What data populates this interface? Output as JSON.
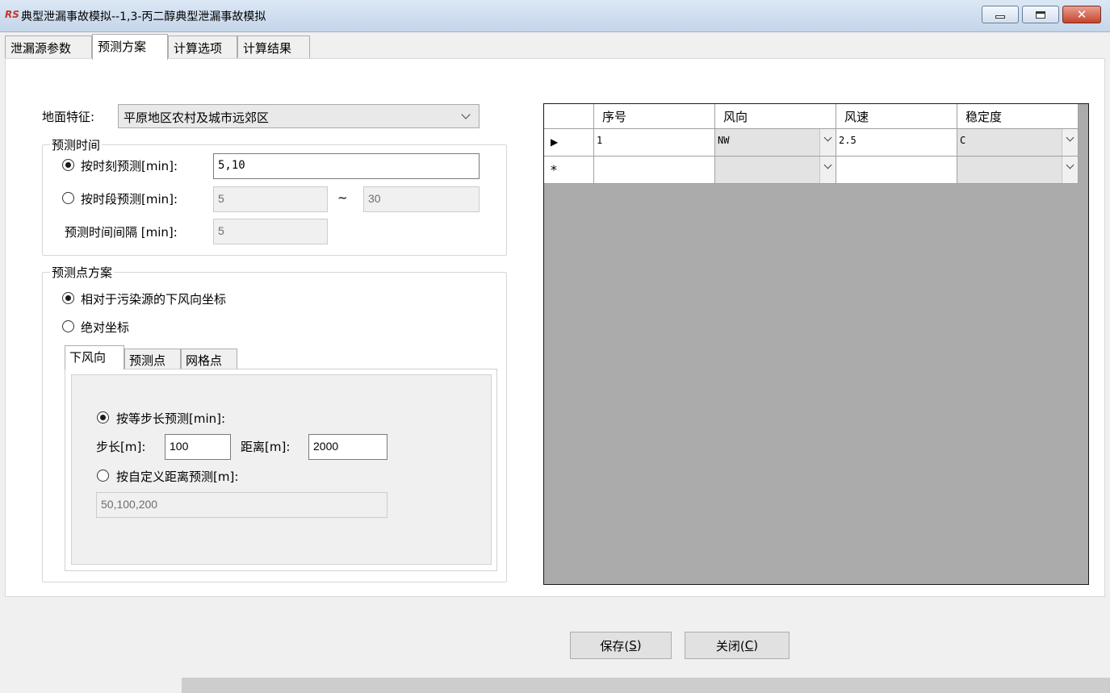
{
  "window": {
    "logo_text": "RS",
    "title": "典型泄漏事故模拟--1,3-丙二醇典型泄漏事故模拟"
  },
  "tabs": [
    "泄漏源参数",
    "预测方案",
    "计算选项",
    "计算结果"
  ],
  "active_tab": "预测方案",
  "ground": {
    "label": "地面特征:",
    "value": "平原地区农村及城市远郊区"
  },
  "time": {
    "title": "预测时间",
    "moment_label": "按时刻预测[min]:",
    "moment_value": "5,10",
    "moment_selected": true,
    "range_label": "按时段预测[min]:",
    "range_from": "5",
    "range_sep": "~",
    "range_to": "30",
    "interval_label": "预测时间间隔 [min]:",
    "interval_value": "5"
  },
  "points": {
    "title": "预测点方案",
    "relative_label": "相对于污染源的下风向坐标",
    "relative_selected": true,
    "absolute_label": "绝对坐标",
    "tabs": [
      "下风向",
      "预测点",
      "网格点"
    ],
    "active_tab": "下风向",
    "step_mode_label": "按等步长预测[min]:",
    "step_label": "步长[m]:",
    "step_value": "100",
    "distance_label": "距离[m]:",
    "distance_value": "2000",
    "custom_label": "按自定义距离预测[m]:",
    "custom_value": "50,100,200"
  },
  "grid": {
    "columns": [
      "序号",
      "风向",
      "风速",
      "稳定度"
    ],
    "rows": [
      {
        "marker": "▶",
        "index": "1",
        "direction": "NW",
        "speed": "2.5",
        "stability": "C"
      },
      {
        "marker": "*",
        "index": "",
        "direction": "",
        "speed": "",
        "stability": ""
      }
    ]
  },
  "buttons": {
    "save": "保存(",
    "save_key": "S",
    "close": "关闭(",
    "close_key": "C",
    "suffix": ")"
  },
  "colors": {
    "close_button": "#c7432c",
    "grid_background": "#ababab"
  }
}
